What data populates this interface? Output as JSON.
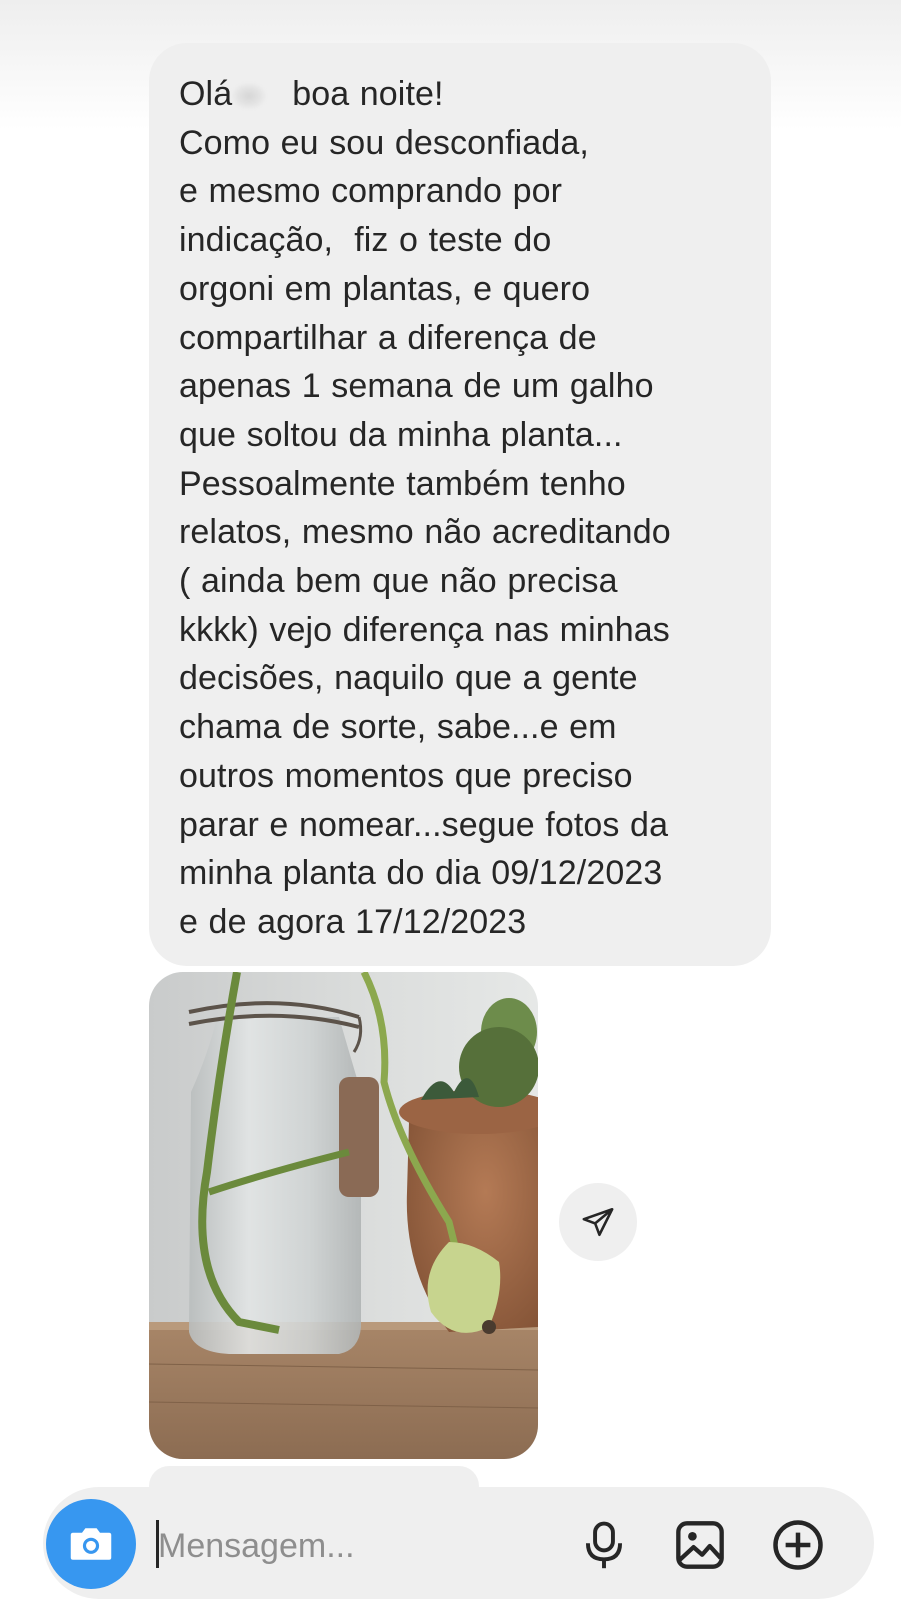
{
  "message": {
    "greeting_before": "Olá",
    "greeting_after": "boa noite!",
    "body": "Como eu sou desconfiada,\ne mesmo comprando por\nindicação,  fiz o teste do\norgoni em plantas, e quero\ncompartilhar a diferença de\napenas 1 semana de um galho\nque soltou da minha planta...\nPessoalmente também tenho\nrelatos, mesmo não acreditando\n( ainda bem que não precisa\nkkkk) vejo diferença nas minhas\ndecisões, naquilo que a gente\nchama de sorte, sabe...e em\noutros momentos que preciso\nparar e nomear...segue fotos da\nminha planta do dia 09/12/2023\ne de agora 17/12/2023",
    "bubble_color": "#efefef"
  },
  "attachment": {
    "type": "photo",
    "share_icon": "paper-plane-icon"
  },
  "composer": {
    "placeholder": "Mensagem...",
    "camera_icon": "camera-icon",
    "mic_icon": "microphone-icon",
    "gallery_icon": "gallery-icon",
    "add_icon": "plus-circle-icon",
    "accent_color": "#3797f0"
  }
}
